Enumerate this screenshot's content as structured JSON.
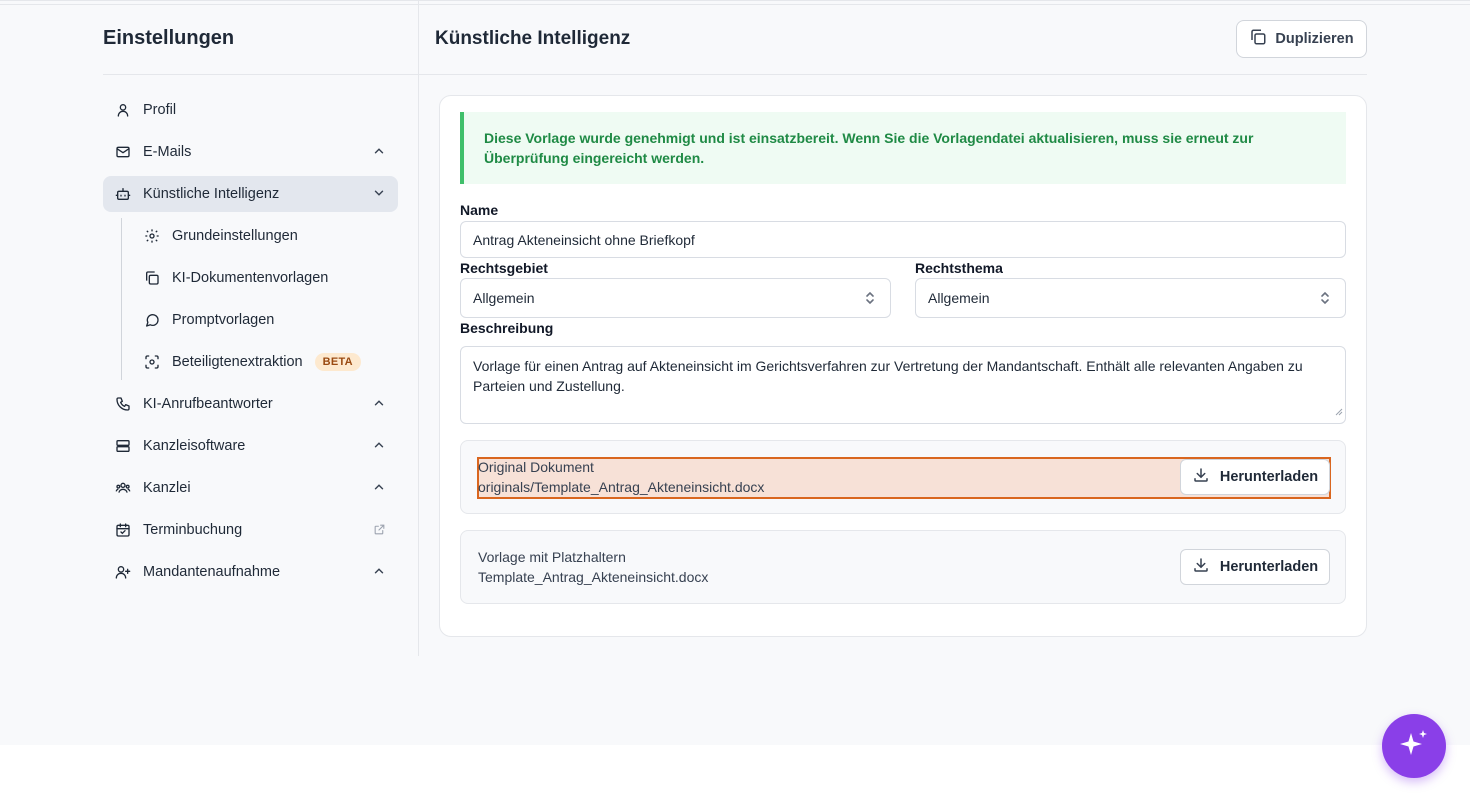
{
  "sidebar": {
    "title": "Einstellungen",
    "items": [
      {
        "label": "Profil",
        "icon": "user-icon"
      },
      {
        "label": "E-Mails",
        "icon": "mail-icon"
      },
      {
        "label": "Künstliche Intelligenz",
        "icon": "bot-icon"
      },
      {
        "label": "KI-Anrufbeantworter",
        "icon": "phone-icon"
      },
      {
        "label": "Kanzleisoftware",
        "icon": "server-icon"
      },
      {
        "label": "Kanzlei",
        "icon": "users-icon"
      },
      {
        "label": "Terminbuchung",
        "icon": "calendar-icon"
      },
      {
        "label": "Mandantenaufnahme",
        "icon": "user-plus-icon"
      }
    ],
    "sub_items": [
      {
        "label": "Grundeinstellungen",
        "icon": "gear-icon"
      },
      {
        "label": "KI-Dokumentenvorlagen",
        "icon": "copy-icon"
      },
      {
        "label": "Promptvorlagen",
        "icon": "chat-icon"
      },
      {
        "label": "Beteiligtenextraktion",
        "icon": "scan-face-icon",
        "badge": "BETA"
      }
    ]
  },
  "main": {
    "title": "Künstliche Intelligenz",
    "duplicate_label": "Duplizieren",
    "alert": "Diese Vorlage wurde genehmigt und ist einsatzbereit. Wenn Sie die Vorlagendatei aktualisieren, muss sie erneut zur Überprüfung eingereicht werden.",
    "name_label": "Name",
    "name_value": "Antrag Akteneinsicht ohne Briefkopf",
    "rechtsgebiet_label": "Rechtsgebiet",
    "rechtsgebiet_value": "Allgemein",
    "rechtsthema_label": "Rechtsthema",
    "rechtsthema_value": "Allgemein",
    "beschreibung_label": "Beschreibung",
    "beschreibung_value": "Vorlage für einen Antrag auf Akteneinsicht im Gerichtsverfahren zur Vertretung der Mandantschaft. Enthält alle relevanten Angaben zu Parteien und Zustellung.",
    "original": {
      "title": "Original Dokument",
      "file": "originals/Template_Antrag_Akteneinsicht.docx",
      "button": "Herunterladen"
    },
    "vorlage": {
      "title": "Vorlage mit Platzhaltern",
      "file": "Template_Antrag_Akteneinsicht.docx",
      "button": "Herunterladen"
    }
  },
  "colors": {
    "accent": "#8a3fe8",
    "success": "#1f8a45",
    "highlight_border": "#d9661f"
  }
}
